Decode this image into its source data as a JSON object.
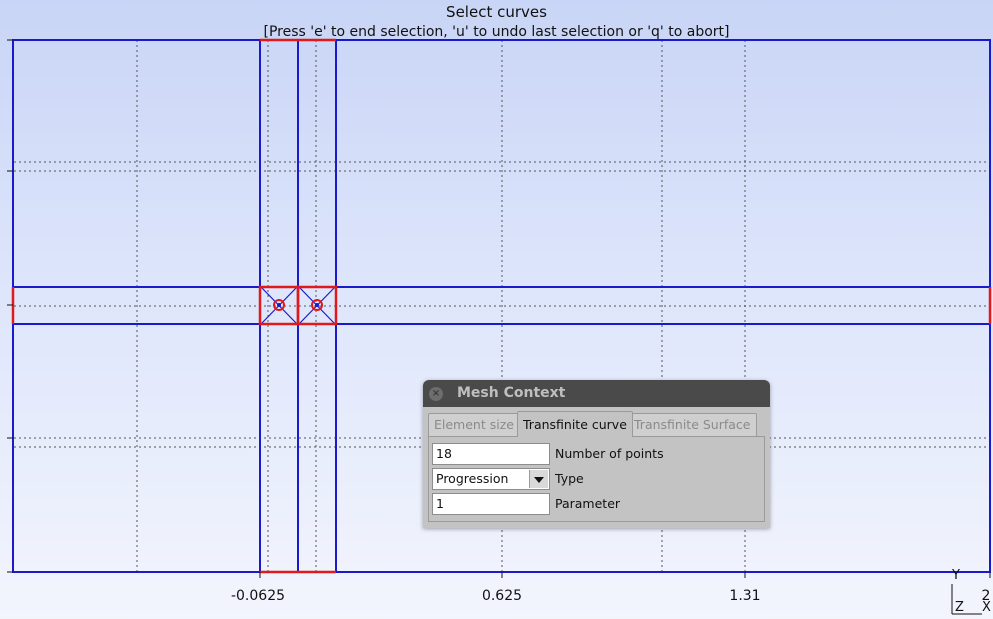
{
  "status": {
    "title": "Select curves",
    "hint": "[Press 'e' to end selection, 'u' to undo last selection or 'q' to abort]"
  },
  "axes": {
    "x_ticks": [
      "-0.0625",
      "0.625",
      "1.31",
      "2"
    ],
    "triad": {
      "y": "Y",
      "z": "Z",
      "x": "X"
    }
  },
  "colors": {
    "curve": "#1a1acc",
    "selected_curve": "#e01a1a",
    "grid": "#555555"
  },
  "dialog": {
    "title": "Mesh Context",
    "tabs": [
      "Element size",
      "Transfinite curve",
      "Transfinite Surface"
    ],
    "active_tab": "Transfinite curve",
    "fields": {
      "points_value": "18",
      "points_label": "Number of points",
      "type_value": "Progression",
      "type_label": "Type",
      "param_value": "1",
      "param_label": "Parameter"
    }
  }
}
